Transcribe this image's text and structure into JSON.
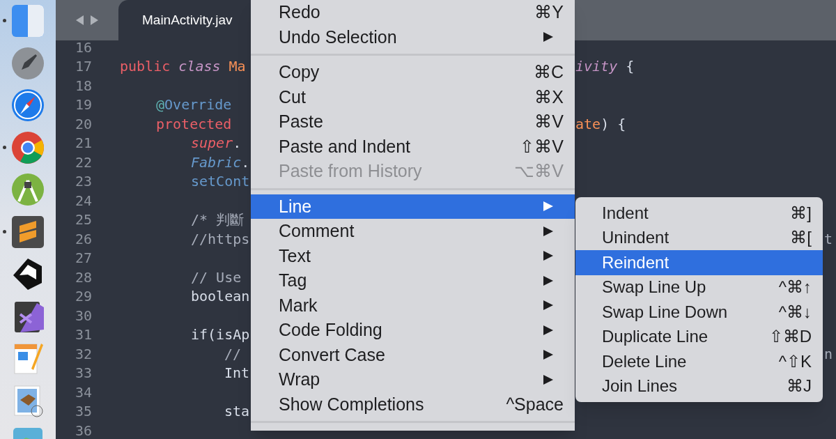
{
  "dock": [
    {
      "running": true
    },
    {
      "running": false
    },
    {
      "running": false
    },
    {
      "running": true
    },
    {
      "running": false
    },
    {
      "running": true
    },
    {
      "running": false
    },
    {
      "running": false
    },
    {
      "running": false
    },
    {
      "running": false
    },
    {
      "running": false
    }
  ],
  "editor": {
    "tab_title": "MainActivity.jav",
    "code_lines": [
      {
        "number": "16"
      },
      {
        "number": "17",
        "segments": [
          {
            "text": "public ",
            "kind": "keyword"
          },
          {
            "text": "class ",
            "kind": "storage"
          },
          {
            "text": "Ma",
            "kind": "type"
          }
        ],
        "right": {
          "kind": "between",
          "segments": [
            {
              "text": "ivity",
              "kind": "storage"
            },
            {
              "text": " {",
              "kind": "plain"
            }
          ]
        },
        "children": [
          {
            "number": "18"
          },
          {
            "number": "19",
            "segments": [
              {
                "text": "@",
                "kind": "annotation"
              },
              {
                "text": "Override",
                "kind": "function"
              }
            ]
          },
          {
            "number": "20",
            "segments": [
              {
                "text": "protected",
                "kind": "keyword"
              }
            ],
            "right": {
              "kind": "between",
              "segments": [
                {
                  "text": "ate",
                  "kind": "type"
                },
                {
                  "text": ") {",
                  "kind": "plain"
                }
              ]
            },
            "children": [
              {
                "number": "21",
                "segments": [
                  {
                    "text": "super",
                    "kind": "italic_keyword"
                  },
                  {
                    "text": ".",
                    "kind": "plain"
                  }
                ]
              },
              {
                "number": "22",
                "segments": [
                  {
                    "text": "Fabric",
                    "kind": "italic_function"
                  },
                  {
                    "text": ".",
                    "kind": "plain"
                  }
                ]
              },
              {
                "number": "23",
                "segments": [
                  {
                    "text": "setCont",
                    "kind": "function"
                  }
                ]
              },
              {
                "number": "24"
              },
              {
                "number": "25",
                "segments": [
                  {
                    "text": "/* 判斷",
                    "kind": "comment"
                  }
                ]
              },
              {
                "number": "26",
                "segments": [
                  {
                    "text": "//https",
                    "kind": "comment"
                  }
                ],
                "right": {
                  "kind": "edge",
                  "segments": [
                    {
                      "text": "t",
                      "kind": "comment"
                    }
                  ]
                }
              },
              {
                "number": "27"
              },
              {
                "number": "28",
                "segments": [
                  {
                    "text": "// Use",
                    "kind": "comment"
                  }
                ]
              },
              {
                "number": "29",
                "segments": [
                  {
                    "text": "boolean",
                    "kind": "plain"
                  }
                ]
              },
              {
                "number": "30"
              },
              {
                "number": "31",
                "segments": [
                  {
                    "text": "if(isAp",
                    "kind": "plain"
                  }
                ],
                "children": [
                  {
                    "number": "32",
                    "segments": [
                      {
                        "text": "//",
                        "kind": "comment"
                      }
                    ],
                    "right": {
                      "kind": "edge",
                      "segments": [
                        {
                          "text": "n",
                          "kind": "comment"
                        }
                      ]
                    }
                  },
                  {
                    "number": "33",
                    "segments": [
                      {
                        "text": "Int",
                        "kind": "plain"
                      }
                    ]
                  },
                  {
                    "number": "34"
                  },
                  {
                    "number": "35",
                    "segments": [
                      {
                        "text": "sta",
                        "kind": "plain"
                      }
                    ]
                  },
                  {
                    "number": "36"
                  }
                ]
              }
            ]
          }
        ]
      }
    ]
  },
  "edit_menu": [
    {
      "kind": "item",
      "label": "Redo",
      "shortcut": "⌘Y",
      "submenu": false,
      "disabled": false,
      "selected": false
    },
    {
      "kind": "item",
      "label": "Undo Selection",
      "submenu": true,
      "disabled": false,
      "selected": false
    },
    {
      "kind": "separator"
    },
    {
      "kind": "item",
      "label": "Copy",
      "shortcut": "⌘C",
      "submenu": false,
      "disabled": false,
      "selected": false
    },
    {
      "kind": "item",
      "label": "Cut",
      "shortcut": "⌘X",
      "submenu": false,
      "disabled": false,
      "selected": false
    },
    {
      "kind": "item",
      "label": "Paste",
      "shortcut": "⌘V",
      "submenu": false,
      "disabled": false,
      "selected": false
    },
    {
      "kind": "item",
      "label": "Paste and Indent",
      "shortcut": "⇧⌘V",
      "submenu": false,
      "disabled": false,
      "selected": false
    },
    {
      "kind": "item",
      "label": "Paste from History",
      "shortcut": "⌥⌘V",
      "submenu": false,
      "disabled": true,
      "selected": false
    },
    {
      "kind": "separator"
    },
    {
      "kind": "item",
      "label": "Line",
      "submenu": true,
      "disabled": false,
      "selected": true
    },
    {
      "kind": "item",
      "label": "Comment",
      "submenu": true,
      "disabled": false,
      "selected": false
    },
    {
      "kind": "item",
      "label": "Text",
      "submenu": true,
      "disabled": false,
      "selected": false
    },
    {
      "kind": "item",
      "label": "Tag",
      "submenu": true,
      "disabled": false,
      "selected": false
    },
    {
      "kind": "item",
      "label": "Mark",
      "submenu": true,
      "disabled": false,
      "selected": false
    },
    {
      "kind": "item",
      "label": "Code Folding",
      "submenu": true,
      "disabled": false,
      "selected": false
    },
    {
      "kind": "item",
      "label": "Convert Case",
      "submenu": true,
      "disabled": false,
      "selected": false
    },
    {
      "kind": "item",
      "label": "Wrap",
      "submenu": true,
      "disabled": false,
      "selected": false
    },
    {
      "kind": "item",
      "label": "Show Completions",
      "shortcut": "^Space",
      "submenu": false,
      "disabled": false,
      "selected": false
    },
    {
      "kind": "separator"
    }
  ],
  "line_submenu": [
    {
      "label": "Indent",
      "shortcut": "⌘]",
      "selected": false
    },
    {
      "label": "Unindent",
      "shortcut": "⌘[",
      "selected": false
    },
    {
      "label": "Reindent",
      "selected": true
    },
    {
      "label": "Swap Line Up",
      "shortcut": "^⌘↑",
      "selected": false
    },
    {
      "label": "Swap Line Down",
      "shortcut": "^⌘↓",
      "selected": false
    },
    {
      "label": "Duplicate Line",
      "shortcut": "⇧⌘D",
      "selected": false
    },
    {
      "label": "Delete Line",
      "shortcut": "^⇧K",
      "selected": false
    },
    {
      "label": "Join Lines",
      "shortcut": "⌘J",
      "selected": false
    }
  ]
}
